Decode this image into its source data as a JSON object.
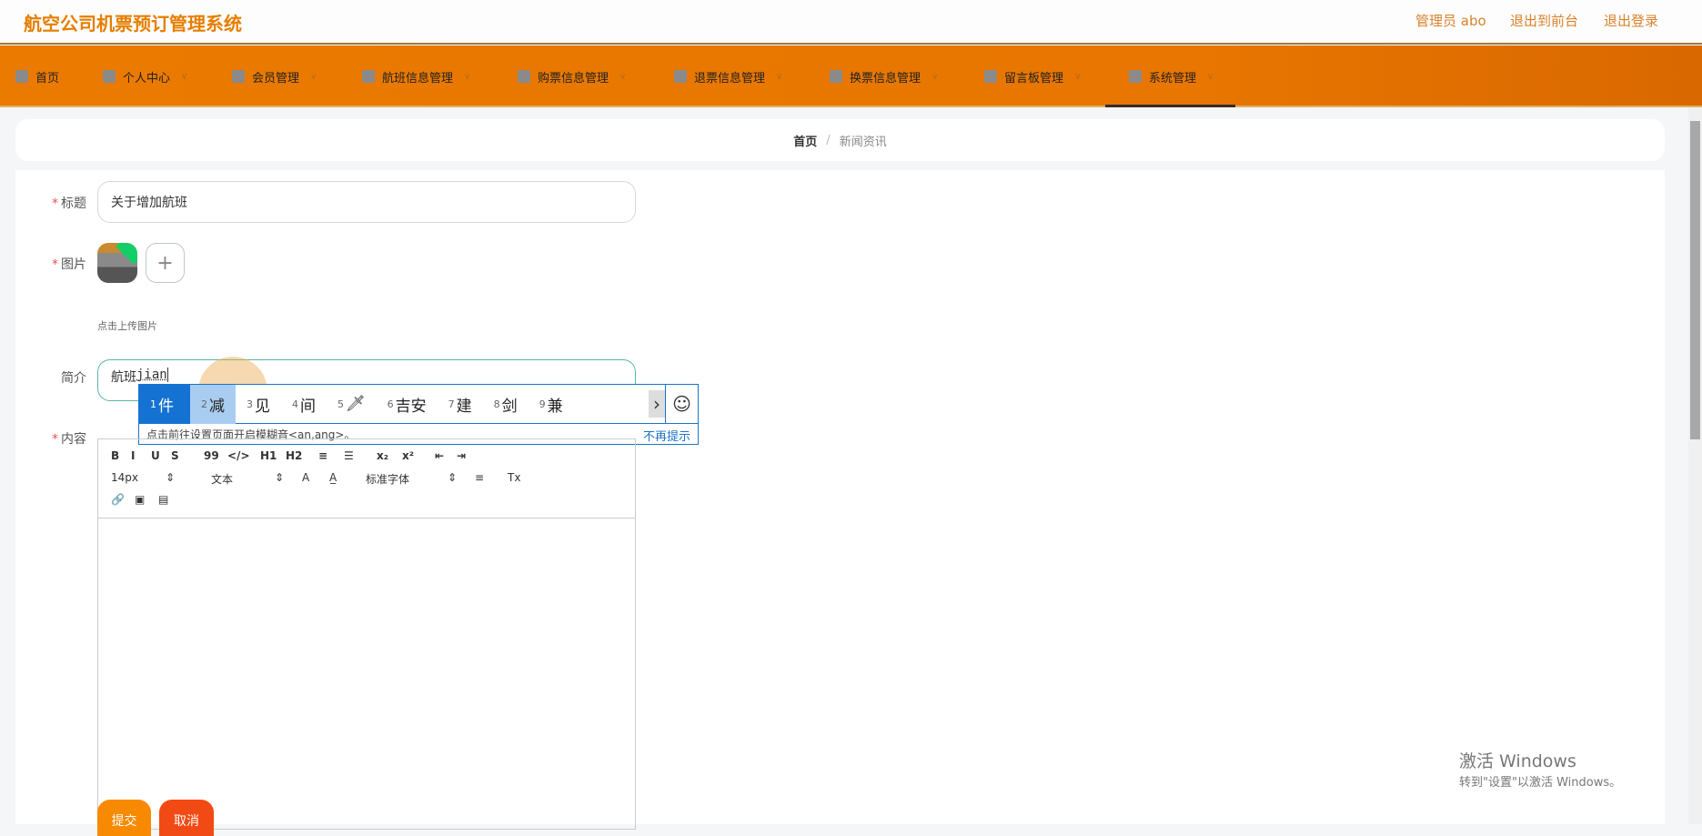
{
  "header": {
    "title": "航空公司机票预订管理系统",
    "admin": "管理员 abo",
    "to_front": "退出到前台",
    "logout": "退出登录"
  },
  "nav": [
    {
      "label": "首页",
      "icon": "home-icon"
    },
    {
      "label": "个人中心",
      "icon": "user-icon"
    },
    {
      "label": "会员管理",
      "icon": "member-icon"
    },
    {
      "label": "航班信息管理",
      "icon": "list-icon"
    },
    {
      "label": "购票信息管理",
      "icon": "list-icon"
    },
    {
      "label": "退票信息管理",
      "icon": "copy-icon"
    },
    {
      "label": "换票信息管理",
      "icon": "brush-icon"
    },
    {
      "label": "留言板管理",
      "icon": "message-icon"
    },
    {
      "label": "系统管理",
      "icon": "gear-icon"
    }
  ],
  "breadcrumb": {
    "home": "首页",
    "sep": "/",
    "current": "新闻资讯"
  },
  "form": {
    "title_label": "标题",
    "title_value": "关于增加航班",
    "image_label": "图片",
    "upload_hint": "点击上传图片",
    "plus": "+",
    "intro_label": "简介",
    "intro_value": "航班",
    "intro_composing": "jian",
    "content_label": "内容",
    "required": "*"
  },
  "ime": {
    "candidates": [
      {
        "n": "1",
        "t": "件"
      },
      {
        "n": "2",
        "t": "减"
      },
      {
        "n": "3",
        "t": "见"
      },
      {
        "n": "4",
        "t": "间"
      },
      {
        "n": "5",
        "t": "🗡"
      },
      {
        "n": "6",
        "t": "吉安"
      },
      {
        "n": "7",
        "t": "建"
      },
      {
        "n": "8",
        "t": "剑"
      },
      {
        "n": "9",
        "t": "兼"
      }
    ],
    "next": "›",
    "emoji": "☺",
    "hint": "点击前往设置页面开启模糊音<an,ang>。",
    "dismiss": "不再提示"
  },
  "toolbar": {
    "row1": [
      "B",
      "I",
      "U",
      "S",
      "99",
      "</>",
      "H1",
      "H2",
      "≡",
      "☰",
      "x₂",
      "x²",
      "⇤",
      "⇥"
    ],
    "size": "14px",
    "header": "文本",
    "font": "标准字体",
    "updown": "⇕",
    "row2_icons": [
      "A",
      "A̲",
      "≡",
      "Tx"
    ],
    "row3": [
      "🔗",
      "▣",
      "▤"
    ]
  },
  "buttons": {
    "submit": "提交",
    "cancel": "取消",
    "submit_color": "#f78a00",
    "cancel_color": "#f24a14"
  },
  "watermark": {
    "line1": "激活 Windows",
    "line2": "转到\"设置\"以激活 Windows。"
  }
}
